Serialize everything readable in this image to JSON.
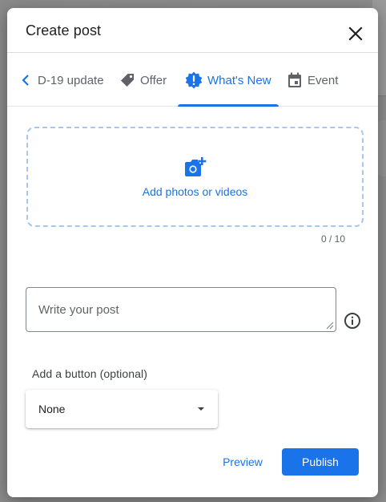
{
  "dialog": {
    "title": "Create post",
    "close_icon": "close-icon"
  },
  "tabs": {
    "scroll_left_icon": "chevron-left-icon",
    "items": [
      {
        "label": "D-19 update",
        "icon": "",
        "active": false
      },
      {
        "label": "Offer",
        "icon": "tag-icon",
        "active": false
      },
      {
        "label": "What's New",
        "icon": "new-badge-icon",
        "active": true
      },
      {
        "label": "Event",
        "icon": "calendar-icon",
        "active": false
      }
    ]
  },
  "media": {
    "upload_label": "Add photos or videos",
    "icon": "add-photo-icon",
    "counter": "0 / 10"
  },
  "post": {
    "placeholder": "Write your post",
    "value": ""
  },
  "action_button": {
    "label": "Add a button (optional)",
    "selected": "None"
  },
  "footer": {
    "preview_label": "Preview",
    "publish_label": "Publish"
  },
  "colors": {
    "accent": "#1a73e8",
    "dashed_border": "#a8c7f0",
    "text_secondary": "#5f6368"
  }
}
